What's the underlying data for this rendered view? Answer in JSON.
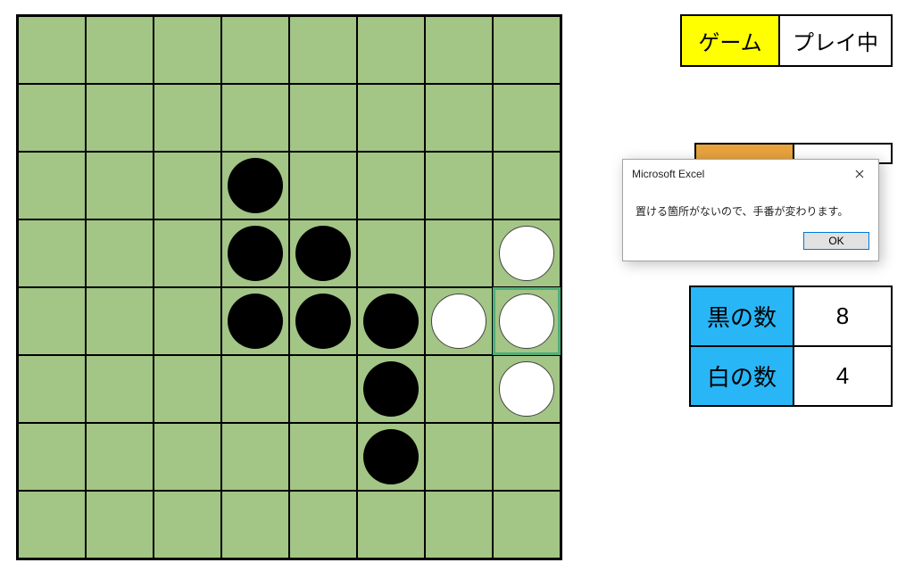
{
  "board": {
    "size": 8,
    "cells": [
      {
        "row": 2,
        "col": 3,
        "color": "black"
      },
      {
        "row": 3,
        "col": 3,
        "color": "black"
      },
      {
        "row": 3,
        "col": 4,
        "color": "black"
      },
      {
        "row": 3,
        "col": 7,
        "color": "white"
      },
      {
        "row": 4,
        "col": 3,
        "color": "black"
      },
      {
        "row": 4,
        "col": 4,
        "color": "black"
      },
      {
        "row": 4,
        "col": 5,
        "color": "black"
      },
      {
        "row": 4,
        "col": 6,
        "color": "white"
      },
      {
        "row": 4,
        "col": 7,
        "color": "white",
        "selected": true
      },
      {
        "row": 5,
        "col": 5,
        "color": "black"
      },
      {
        "row": 5,
        "col": 7,
        "color": "white"
      },
      {
        "row": 6,
        "col": 5,
        "color": "black"
      }
    ]
  },
  "status": {
    "game_label": "ゲーム",
    "game_state": "プレイ中"
  },
  "turn": {
    "label": "",
    "value": ""
  },
  "score": {
    "black_label": "黒の数",
    "black_count": "8",
    "white_label": "白の数",
    "white_count": "4"
  },
  "dialog": {
    "title": "Microsoft Excel",
    "message": "置ける箇所がないので、手番が変わります。",
    "ok_label": "OK"
  }
}
